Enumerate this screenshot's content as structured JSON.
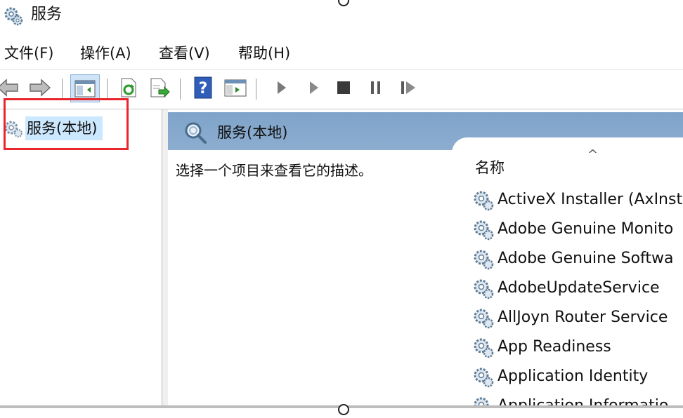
{
  "window": {
    "title": "服务"
  },
  "menu": {
    "items": [
      {
        "label": "文件(F)"
      },
      {
        "label": "操作(A)"
      },
      {
        "label": "查看(V)"
      },
      {
        "label": "帮助(H)"
      }
    ]
  },
  "toolbar": {
    "buttons": [
      "back-arrow-icon",
      "forward-arrow-icon",
      "console-tree-icon",
      "refresh-icon",
      "export-list-icon",
      "help-icon",
      "properties-icon",
      "play-icon",
      "play-outline-icon",
      "stop-icon",
      "pause-icon",
      "restart-icon"
    ]
  },
  "tree": {
    "root_label": "服务(本地)"
  },
  "detail": {
    "header": "服务(本地)",
    "description": "选择一个项目来查看它的描述。",
    "column_name": "名称",
    "sort_indicator": "^",
    "services": [
      {
        "name": "ActiveX Installer (AxInst"
      },
      {
        "name": "Adobe Genuine Monito"
      },
      {
        "name": "Adobe Genuine Softwa"
      },
      {
        "name": "AdobeUpdateService"
      },
      {
        "name": "AllJoyn Router Service"
      },
      {
        "name": "App Readiness"
      },
      {
        "name": "Application Identity"
      },
      {
        "name": "Application Informatio"
      }
    ]
  },
  "colors": {
    "highlight_border": "#e8262b",
    "selection": "#cce8ff",
    "header_bg": "#8cadd0"
  }
}
